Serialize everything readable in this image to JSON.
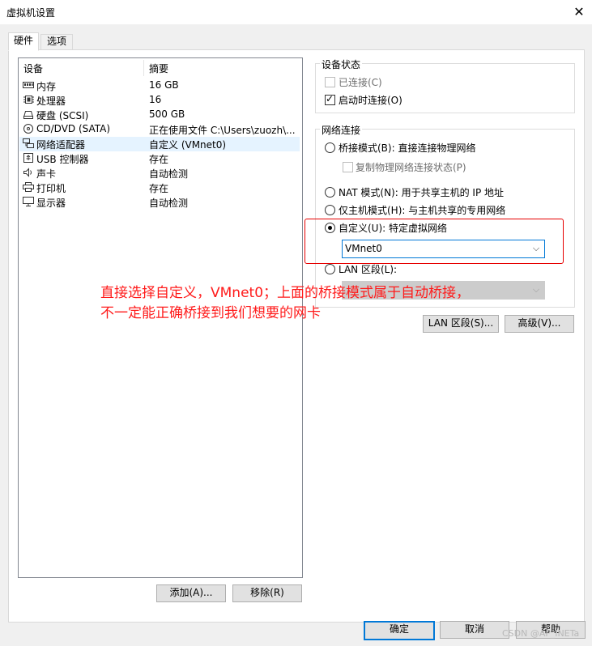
{
  "window": {
    "title": "虚拟机设置"
  },
  "tabs": [
    {
      "label": "硬件",
      "active": true
    },
    {
      "label": "选项",
      "active": false
    }
  ],
  "device_list": {
    "columns": [
      "设备",
      "摘要"
    ],
    "rows": [
      {
        "icon": "memory-icon",
        "name": "内存",
        "summary": "16 GB"
      },
      {
        "icon": "cpu-icon",
        "name": "处理器",
        "summary": "16"
      },
      {
        "icon": "disk-icon",
        "name": "硬盘 (SCSI)",
        "summary": "500 GB"
      },
      {
        "icon": "cdrom-icon",
        "name": "CD/DVD (SATA)",
        "summary": "正在使用文件 C:\\Users\\zuozh\\..."
      },
      {
        "icon": "network-adapter-icon",
        "name": "网络适配器",
        "summary": "自定义 (VMnet0)",
        "selected": true
      },
      {
        "icon": "usb-icon",
        "name": "USB 控制器",
        "summary": "存在"
      },
      {
        "icon": "speaker-icon",
        "name": "声卡",
        "summary": "自动检测"
      },
      {
        "icon": "printer-icon",
        "name": "打印机",
        "summary": "存在"
      },
      {
        "icon": "monitor-icon",
        "name": "显示器",
        "summary": "自动检测"
      }
    ]
  },
  "device_status": {
    "title": "设备状态",
    "connected": {
      "label": "已连接(C)",
      "checked": false,
      "enabled": false
    },
    "connect_at_power_on": {
      "label": "启动时连接(O)",
      "checked": true,
      "enabled": true
    }
  },
  "network_connection": {
    "title": "网络连接",
    "bridged": {
      "label": "桥接模式(B): 直接连接物理网络",
      "selected": false
    },
    "replicate_state": {
      "label": "复制物理网络连接状态(P)",
      "checked": false,
      "enabled": false
    },
    "nat": {
      "label": "NAT 模式(N): 用于共享主机的 IP 地址",
      "selected": false
    },
    "host_only": {
      "label": "仅主机模式(H): 与主机共享的专用网络",
      "selected": false
    },
    "custom": {
      "label": "自定义(U): 特定虚拟网络",
      "selected": true
    },
    "custom_select_value": "VMnet0",
    "lan_segment": {
      "label": "LAN 区段(L):",
      "selected": false
    },
    "lan_select_value": ""
  },
  "buttons": {
    "lan_segments": "LAN 区段(S)...",
    "advanced": "高级(V)...",
    "add": "添加(A)...",
    "remove": "移除(R)",
    "ok": "确定",
    "cancel": "取消",
    "help": "帮助"
  },
  "annotation": {
    "line1": "直接选择自定义，VMnet0；上面的桥接模式属于自动桥接，",
    "line2": "不一定能正确桥接到我们想要的网卡",
    "color": "#ff1a1a"
  },
  "watermark": "CSDN @AF_INETa",
  "colors": {
    "selection": "#e5f3ff",
    "focus_border": "#0078d7",
    "annotation_border": "#e60000"
  }
}
